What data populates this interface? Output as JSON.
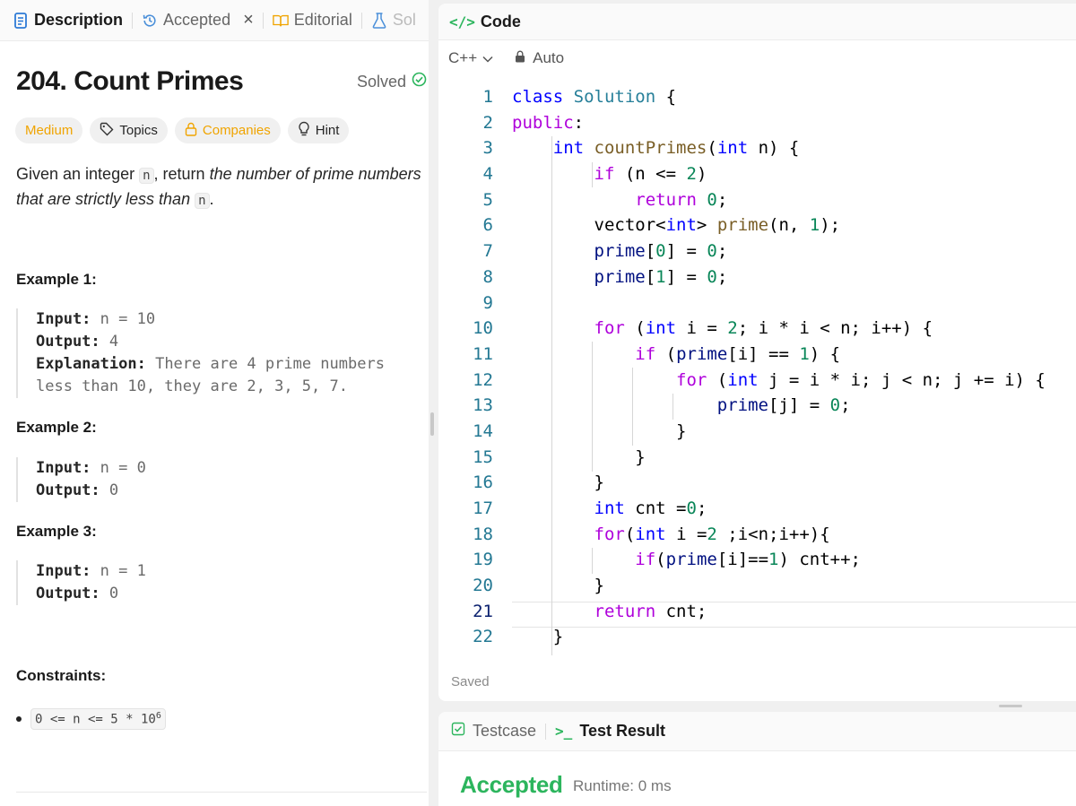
{
  "left_tabs": [
    {
      "label": "Description",
      "icon": "document-icon",
      "active": true
    },
    {
      "label": "Accepted",
      "icon": "history-icon",
      "active": false,
      "closable": true
    },
    {
      "label": "Editorial",
      "icon": "book-icon",
      "active": false
    },
    {
      "label": "Sol",
      "icon": "flask-icon",
      "active": false
    }
  ],
  "problem": {
    "title": "204. Count Primes",
    "status": "Solved",
    "tags": [
      "Medium",
      "Topics",
      "Companies",
      "Hint"
    ],
    "desc_pre": "Given an integer ",
    "desc_code1": "n",
    "desc_mid": ", return ",
    "desc_em": "the number of prime numbers that are strictly less than ",
    "desc_code2": "n",
    "desc_post": "."
  },
  "examples": [
    {
      "heading": "Example 1:",
      "input_label": "Input:",
      "input": "n = 10",
      "output_label": "Output:",
      "output": "4",
      "explanation_label": "Explanation:",
      "explanation_1": "There are 4 prime numbers",
      "explanation_2": "less than 10, they are 2, 3, 5, 7."
    },
    {
      "heading": "Example 2:",
      "input_label": "Input:",
      "input": "n = 0",
      "output_label": "Output:",
      "output": "0"
    },
    {
      "heading": "Example 3:",
      "input_label": "Input:",
      "input": "n = 1",
      "output_label": "Output:",
      "output": "0"
    }
  ],
  "constraints": {
    "heading": "Constraints:",
    "item": "0 <= n <= 5 * 10",
    "exponent": "6"
  },
  "code_panel": {
    "title": "Code",
    "language": "C++",
    "mode": "Auto",
    "saved": "Saved",
    "current_line": 21
  },
  "code_lines": [
    "class Solution {",
    "public:",
    "    int countPrimes(int n) {",
    "        if (n <= 2)",
    "            return 0;",
    "        vector<int> prime(n, 1);",
    "        prime[0] = 0;",
    "        prime[1] = 0;",
    "",
    "        for (int i = 2; i * i < n; i++) {",
    "            if (prime[i] == 1) {",
    "                for (int j = i * i; j < n; j += i) {",
    "                    prime[j] = 0;",
    "                }",
    "            }",
    "        }",
    "        int cnt =0;",
    "        for(int i =2 ;i<n;i++){",
    "            if(prime[i]==1) cnt++;",
    "        }",
    "        return cnt;",
    "    }"
  ],
  "test_panel": {
    "tabs": [
      {
        "label": "Testcase",
        "icon": "checkbox-icon",
        "active": false
      },
      {
        "label": "Test Result",
        "icon": "terminal-icon",
        "active": true
      }
    ],
    "result": "Accepted",
    "runtime": "Runtime: 0 ms"
  },
  "colors": {
    "accepted": "#2cb55d",
    "medium": "#f0a400",
    "keyword": "#af00db",
    "type": "#0000ff",
    "number": "#098658"
  }
}
